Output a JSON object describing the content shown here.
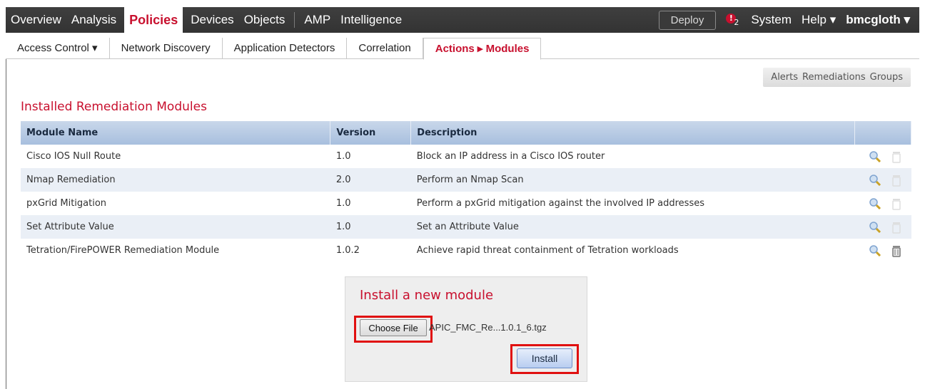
{
  "top_nav": {
    "items": [
      {
        "label": "Overview",
        "active": false
      },
      {
        "label": "Analysis",
        "active": false
      },
      {
        "label": "Policies",
        "active": true
      },
      {
        "label": "Devices",
        "active": false
      },
      {
        "label": "Objects",
        "active": false
      },
      {
        "label": "AMP",
        "active": false
      },
      {
        "label": "Intelligence",
        "active": false
      }
    ],
    "deploy_label": "Deploy",
    "alert_count": "2",
    "system_label": "System",
    "help_label": "Help ▾",
    "user_label": "bmcgloth ▾"
  },
  "sub_nav": {
    "tabs": [
      {
        "label": "Access Control ▾",
        "active": false
      },
      {
        "label": "Network Discovery",
        "active": false
      },
      {
        "label": "Application Detectors",
        "active": false
      },
      {
        "label": "Correlation",
        "active": false
      },
      {
        "label": "Actions ▸ Modules",
        "active": true
      }
    ]
  },
  "right_buttons": {
    "alerts": "Alerts",
    "remediations": "Remediations",
    "groups": "Groups"
  },
  "section_title": "Installed Remediation Modules",
  "table": {
    "headers": [
      "Module Name",
      "Version",
      "Description"
    ],
    "rows": [
      {
        "name": "Cisco IOS Null Route",
        "version": "1.0",
        "description": "Block an IP address in a Cisco IOS router",
        "delete_enabled": false
      },
      {
        "name": "Nmap Remediation",
        "version": "2.0",
        "description": "Perform an Nmap Scan",
        "delete_enabled": false
      },
      {
        "name": "pxGrid Mitigation",
        "version": "1.0",
        "description": "Perform a pxGrid mitigation against the involved IP addresses",
        "delete_enabled": false
      },
      {
        "name": "Set Attribute Value",
        "version": "1.0",
        "description": "Set an Attribute Value",
        "delete_enabled": false
      },
      {
        "name": "Tetration/FirePOWER Remediation Module",
        "version": "1.0.2",
        "description": "Achieve rapid threat containment of Tetration workloads",
        "delete_enabled": true
      }
    ]
  },
  "install": {
    "title": "Install a new module",
    "choose_file_label": "Choose File",
    "file_name": "APIC_FMC_Re...1.0.1_6.tgz",
    "install_label": "Install"
  },
  "colors": {
    "accent": "#c8102e",
    "nav_bg": "#333333",
    "header_blue": "#a8bfde",
    "highlight": "#e01010"
  }
}
